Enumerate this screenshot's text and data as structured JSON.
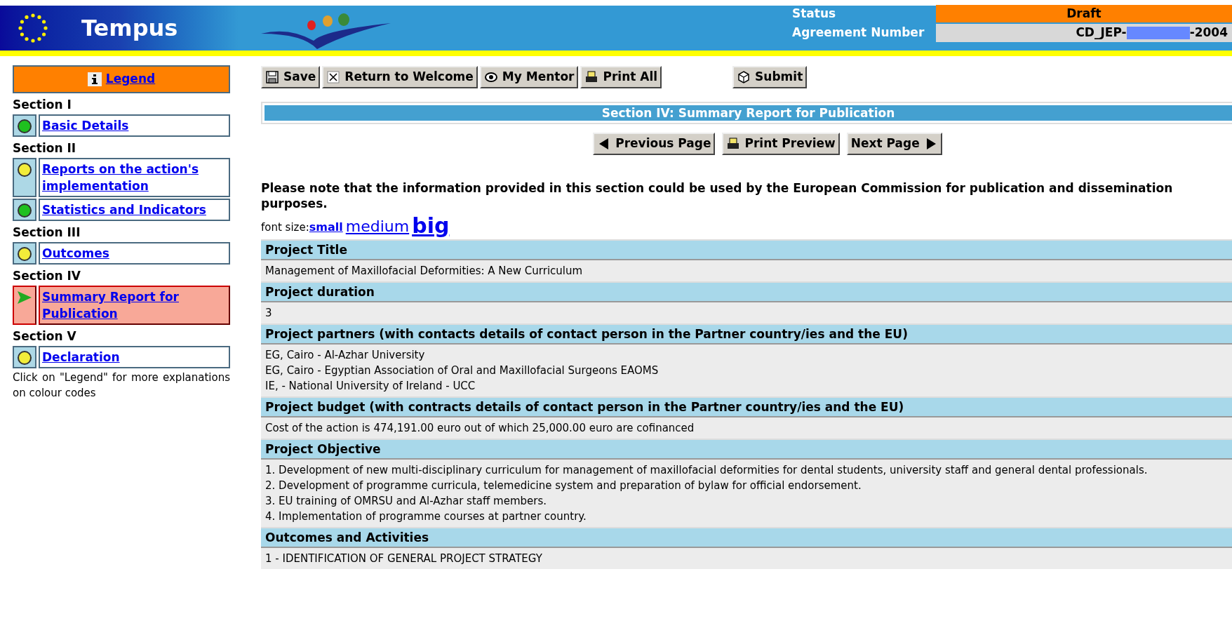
{
  "header": {
    "title": "Tempus",
    "status_label": "Status",
    "status_value": "Draft",
    "agreement_label": "Agreement Number",
    "agreement_prefix": "CD_JEP-",
    "agreement_suffix": "-2004"
  },
  "sidebar": {
    "legend": "Legend",
    "sections": [
      {
        "title": "Section I",
        "items": [
          {
            "label": "Basic Details",
            "color": "#1fc01f",
            "selected": false
          }
        ]
      },
      {
        "title": "Section II",
        "items": [
          {
            "label": "Reports on the action's implementation",
            "color": "#f2ec3a",
            "selected": false
          },
          {
            "label": "Statistics and Indicators",
            "color": "#1fc01f",
            "selected": false
          }
        ]
      },
      {
        "title": "Section III",
        "items": [
          {
            "label": "Outcomes",
            "color": "#f2ec3a",
            "selected": false
          }
        ]
      },
      {
        "title": "Section IV",
        "items": [
          {
            "label": "Summary Report for Publication",
            "selected": true
          }
        ]
      },
      {
        "title": "Section V",
        "items": [
          {
            "label": "Declaration",
            "color": "#f2ec3a",
            "selected": false
          }
        ]
      }
    ],
    "note": "Click on \"Legend\" for more explanations on colour codes"
  },
  "toolbar": [
    {
      "label": "Save",
      "kind": "save"
    },
    {
      "label": "Return to Welcome",
      "kind": "close"
    },
    {
      "label": "My Mentor",
      "kind": "mentor"
    },
    {
      "label": "Print All",
      "kind": "print"
    },
    {
      "label": "Submit",
      "kind": "submit"
    }
  ],
  "section_title": "Section IV: Summary Report for Publication",
  "nav": [
    {
      "label": "Previous Page",
      "kind": "prev"
    },
    {
      "label": "Print Preview",
      "kind": "print"
    },
    {
      "label": "Next Page",
      "kind": "next"
    }
  ],
  "notice": "Please note that the information provided in this section could be used by the European Commission for publication and dissemination purposes.",
  "font_size": {
    "label": "font size:",
    "options": [
      "small",
      "medium",
      "big"
    ]
  },
  "fields": [
    {
      "heading": "Project Title",
      "lines": [
        "Management of Maxillofacial Deformities: A New Curriculum"
      ]
    },
    {
      "heading": "Project duration",
      "lines": [
        "3"
      ]
    },
    {
      "heading": "Project partners (with contacts details of contact person in the Partner country/ies and the EU)",
      "lines": [
        "EG, Cairo - Al-Azhar University",
        "EG, Cairo - Egyptian Association of Oral and Maxillofacial Surgeons EAOMS",
        "IE, - National University of Ireland - UCC"
      ]
    },
    {
      "heading": "Project budget (with contracts details of contact person in the Partner country/ies and the EU)",
      "lines": [
        "Cost of the action is 474,191.00 euro out of which 25,000.00 euro are cofinanced"
      ]
    },
    {
      "heading": "Project Objective",
      "lines": [
        "1. Development of new multi-disciplinary curriculum for management of maxillofacial deformities for dental students, university staff and general dental professionals.",
        "2. Development of programme curricula, telemedicine system and preparation of bylaw for official endorsement.",
        "3. EU training of OMRSU and Al-Azhar staff members.",
        "4. Implementation of programme courses at partner country."
      ]
    },
    {
      "heading": "Outcomes and Activities",
      "lines": [
        "1 - IDENTIFICATION OF GENERAL PROJECT STRATEGY"
      ]
    }
  ]
}
